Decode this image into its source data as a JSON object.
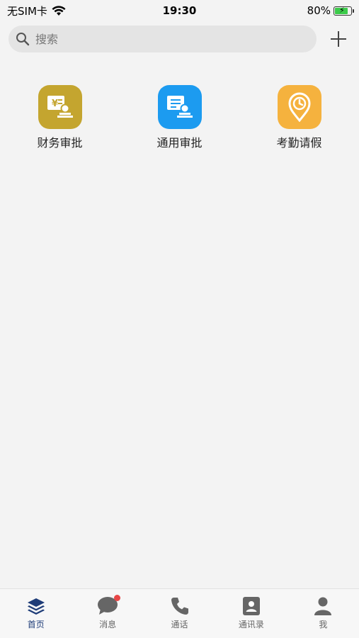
{
  "status_bar": {
    "carrier": "无SIM卡",
    "time": "19:30",
    "battery": "80%",
    "battery_level": 0.8
  },
  "search": {
    "placeholder": "搜索"
  },
  "apps": [
    {
      "label": "财务审批",
      "icon": "finance-approval-icon",
      "color": "#c4a52f"
    },
    {
      "label": "通用审批",
      "icon": "general-approval-icon",
      "color": "#1c9bf0"
    },
    {
      "label": "考勤请假",
      "icon": "attendance-leave-icon",
      "color": "#f5b23e"
    }
  ],
  "tabs": [
    {
      "label": "首页",
      "icon": "home-layers-icon",
      "active": true
    },
    {
      "label": "消息",
      "icon": "message-bubble-icon",
      "badge": true
    },
    {
      "label": "通话",
      "icon": "phone-icon"
    },
    {
      "label": "通讯录",
      "icon": "contacts-icon"
    },
    {
      "label": "我",
      "icon": "profile-icon"
    }
  ],
  "colors": {
    "active_tab": "#1e3c78",
    "badge": "#e84646"
  }
}
